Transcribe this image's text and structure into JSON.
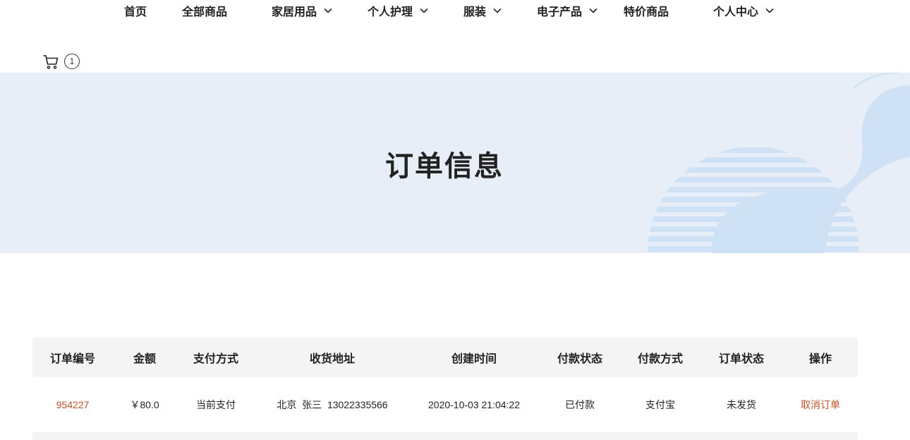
{
  "nav": {
    "items": [
      {
        "label": "首页"
      },
      {
        "label": "全部商品"
      },
      {
        "label": "家居用品",
        "dropdown": true
      },
      {
        "label": "个人护理",
        "dropdown": true
      },
      {
        "label": "服装",
        "dropdown": true
      },
      {
        "label": "电子产品",
        "dropdown": true
      },
      {
        "label": "特价商品"
      },
      {
        "label": "个人中心",
        "dropdown": true
      }
    ],
    "cart_icon": "shopping-cart-icon",
    "cart_count": "1"
  },
  "banner": {
    "title": "订单信息",
    "background_color": "#e7eef7",
    "decoration_color": "#cfe2f5"
  },
  "orders_table": {
    "headers": [
      "订单编号",
      "金额",
      "支付方式",
      "收货地址",
      "创建时间",
      "付款状态",
      "付款方式",
      "订单状态",
      "操作"
    ],
    "rows": [
      {
        "order_no": "954227",
        "amount": "￥80.0",
        "payment_type": "当前支付",
        "address": "北京  张三  13022335566",
        "created_at": "2020-10-03 21:04:22",
        "pay_status": "已付款",
        "pay_method": "支付宝",
        "order_status": "未发货",
        "action": "取消订单"
      }
    ]
  },
  "colors": {
    "link": "#c0532c",
    "header_bg": "#f4f4f4"
  }
}
